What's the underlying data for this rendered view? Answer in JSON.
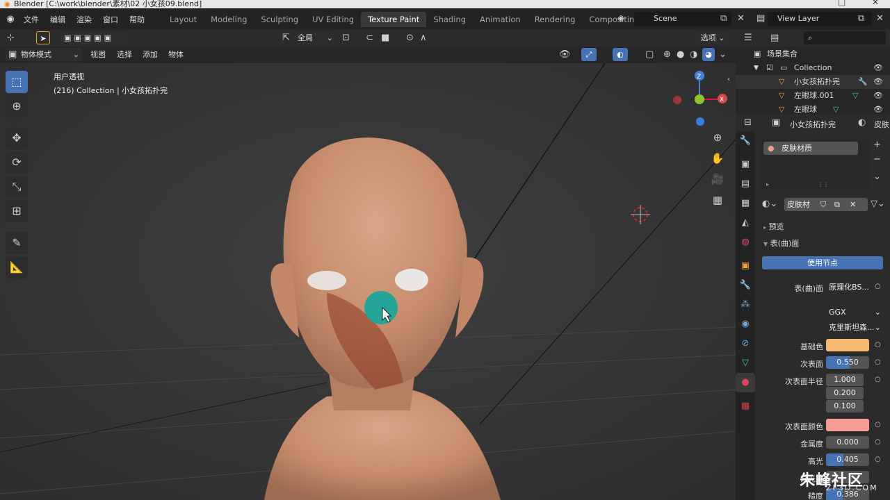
{
  "app": {
    "title": "Blender [C:\\work\\blender\\素材\\02 小女孩09.blend]",
    "menu": [
      "文件",
      "编辑",
      "渲染",
      "窗口",
      "帮助"
    ],
    "workspaces": [
      "Layout",
      "Modeling",
      "Sculpting",
      "UV Editing",
      "Texture Paint",
      "Shading",
      "Animation",
      "Rendering",
      "Compositing",
      "Sc"
    ],
    "active_workspace": "Texture Paint",
    "scene": "Scene",
    "view_layer": "View Layer"
  },
  "viewport_header": {
    "transform_orientation": "全局",
    "options_label": "选项",
    "mode": "物体模式",
    "menus": [
      "视图",
      "选择",
      "添加",
      "物体"
    ]
  },
  "viewport": {
    "view_name": "用户透视",
    "collection_info": "(216) Collection | 小女孩拓扑完",
    "gizmo": {
      "z": "Z",
      "x": "X"
    }
  },
  "outliner": {
    "root": "场景集合",
    "collection": "Collection",
    "objects": [
      "小女孩拓扑完",
      "左眼球.001",
      "左眼球"
    ]
  },
  "properties": {
    "object_name": "小女孩拓扑完",
    "material_tab": "皮肤",
    "material_slot": "皮肤材质",
    "material_name": "皮肤材",
    "sections": {
      "preview": "预览",
      "surface": "表(曲)面"
    },
    "use_nodes": "使用节点",
    "fields": [
      {
        "label": "表(曲)面",
        "value": "原理化BS..."
      },
      {
        "label": "",
        "value": "GGX"
      },
      {
        "label": "",
        "value": "克里斯坦森..."
      },
      {
        "label": "基础色",
        "color": "#f4b870"
      },
      {
        "label": "次表面",
        "value": "0.550",
        "fraction": 0.55
      },
      {
        "label": "次表面半径",
        "value": "1.000"
      },
      {
        "label": "",
        "value": "0.200"
      },
      {
        "label": "",
        "value": "0.100"
      },
      {
        "label": "次表面颜色",
        "color": "#f79c94"
      },
      {
        "label": "金属度",
        "value": "0.000",
        "fraction": 0.0
      },
      {
        "label": "高光",
        "value": "0.405",
        "fraction": 0.405
      },
      {
        "label": "高光染",
        "value": ""
      },
      {
        "label": "糙度",
        "value": "0.386",
        "fraction": 0.386
      }
    ]
  },
  "watermark": {
    "text": "朱峰社区",
    "sub": "ZF3D.COM"
  }
}
